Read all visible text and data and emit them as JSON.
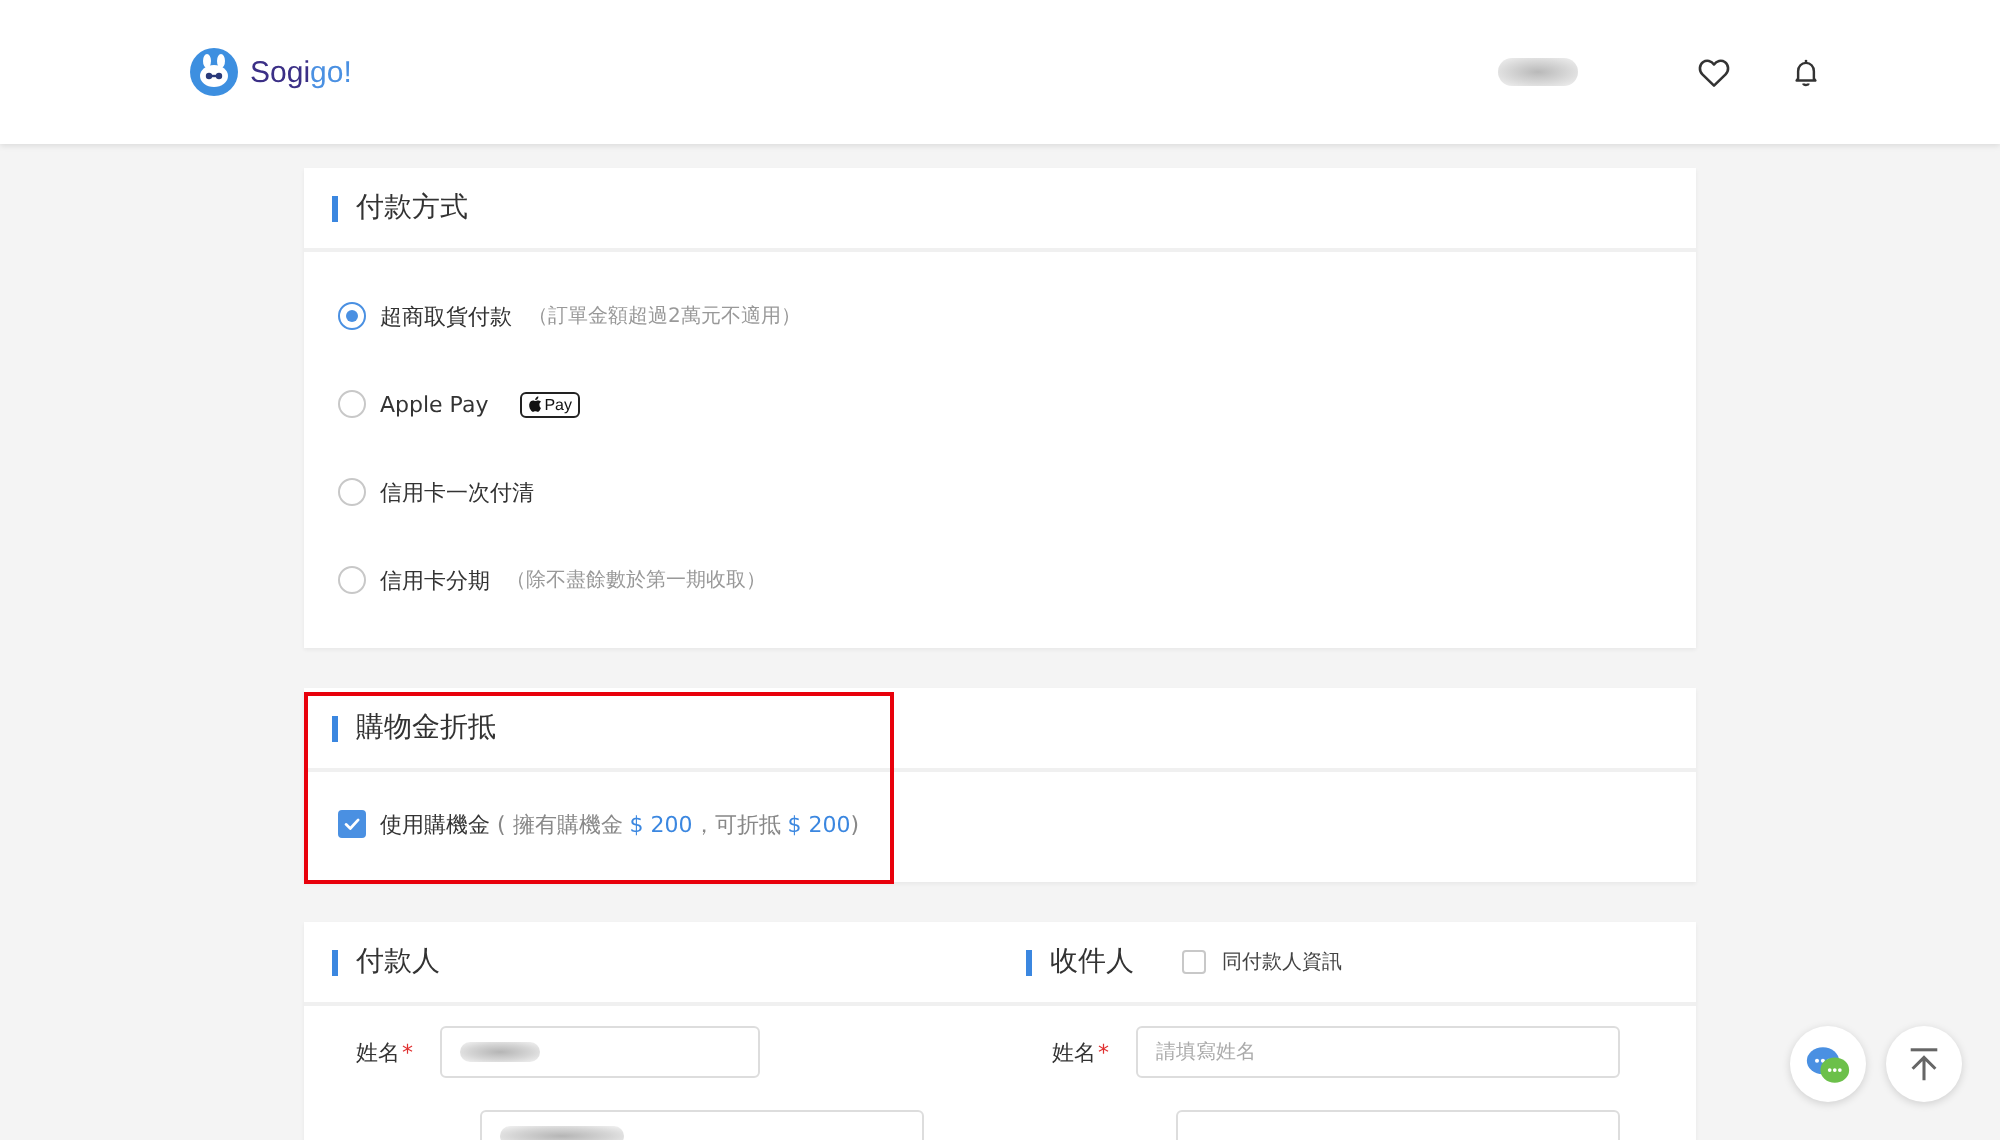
{
  "header": {
    "logo_parts": [
      {
        "text": "Sogi",
        "kind": "dark"
      },
      {
        "text": "go!",
        "kind": "accent"
      }
    ],
    "user_name_redacted": true,
    "actions": [
      {
        "kind": "favorites"
      },
      {
        "kind": "notifications"
      }
    ]
  },
  "payment_method": {
    "title": "付款方式",
    "options": [
      {
        "label": "超商取貨付款",
        "note": "（訂單金額超過2萬元不適用）",
        "selected": true
      },
      {
        "label": "Apple Pay",
        "badge": "Pay",
        "selected": false
      },
      {
        "label": "信用卡一次付清",
        "selected": false
      },
      {
        "label": "信用卡分期",
        "note": "（除不盡餘數於第一期收取）",
        "selected": false
      }
    ]
  },
  "shopping_credit": {
    "title": "購物金折抵",
    "highlighted": true,
    "checkbox": {
      "checked": true,
      "label_parts": [
        {
          "text": "使用購機金",
          "kind": "main"
        },
        {
          "text": " ( 擁有購機金 ",
          "kind": "note"
        },
        {
          "text": "$ 200",
          "kind": "amount"
        },
        {
          "text": "，可折抵 ",
          "kind": "note"
        },
        {
          "text": "$ 200",
          "kind": "amount"
        },
        {
          "text": ")",
          "kind": "note"
        }
      ]
    }
  },
  "payer": {
    "title": "付款人",
    "fields": [
      {
        "kind": "labeled",
        "label": "姓名",
        "required_mark": "*",
        "value_redacted": true
      },
      {
        "kind": "cut",
        "value_redacted": true
      }
    ]
  },
  "recipient": {
    "title": "收件人",
    "same_as_payer": {
      "label": "同付款人資訊",
      "checked": false
    },
    "fields": [
      {
        "kind": "labeled",
        "label": "姓名",
        "required_mark": "*",
        "placeholder": "請填寫姓名"
      },
      {
        "kind": "cut"
      }
    ]
  },
  "floating_buttons": [
    {
      "kind": "chat"
    },
    {
      "kind": "back_to_top"
    }
  ]
}
